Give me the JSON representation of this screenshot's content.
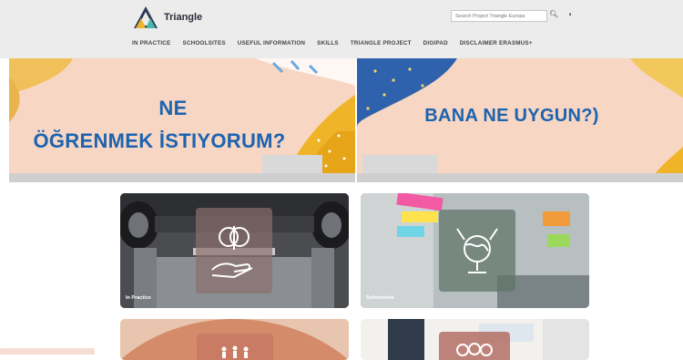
{
  "header": {
    "logo_text": "Triangle",
    "search_placeholder": "Search Project Triangle Europa",
    "search_icon": "search-icon",
    "theme_icon": "contrast-icon"
  },
  "nav": {
    "items": [
      "IN PRACTICE",
      "SCHOOLSITES",
      "USEFUL INFORMATION",
      "SKILLS",
      "TRIANGLE PROJECT",
      "DIGIPAD",
      "DISCLAIMER ERASMUS+"
    ]
  },
  "banners": {
    "left": {
      "line1": "NE",
      "line2": "ÖĞRENMEK İSTIYORUM?"
    },
    "right": {
      "line1": "BANA NE UYGUN?)"
    }
  },
  "cards": [
    {
      "label": "In Practice",
      "icon": "brain-hand-icon"
    },
    {
      "label": "Schoolsites",
      "icon": "globe-tools-icon"
    },
    {
      "label": "",
      "icon": "people-icon"
    },
    {
      "label": "",
      "icon": "group-icon"
    }
  ],
  "colors": {
    "banner_bg": "#f7d6c3",
    "banner_text": "#1d63b0",
    "header_bg": "#ececec"
  }
}
